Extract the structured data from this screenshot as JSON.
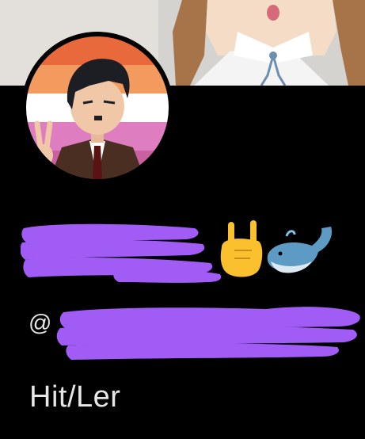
{
  "profile": {
    "handle_prefix": "@",
    "bio": "Hit/Ler",
    "name_emojis": [
      "sign-of-horns-emoji",
      "whale-emoji"
    ],
    "redaction_color": "#a15cf5",
    "avatar_stripe_colors": [
      "#e86a3c",
      "#f39a5e",
      "#ffffff",
      "#de7ec0",
      "#ca5fa2"
    ]
  },
  "icons": {
    "avatar": "avatar-illustration",
    "banner": "banner-illustration"
  }
}
